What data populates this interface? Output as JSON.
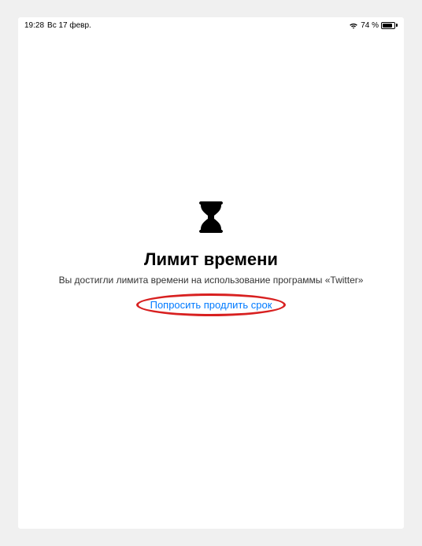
{
  "status_bar": {
    "time": "19:28",
    "date": "Вс 17 февр.",
    "battery_percent": "74 %"
  },
  "screen": {
    "title": "Лимит времени",
    "subtitle": "Вы достигли лимита времени на использование программы «Twitter»",
    "request_button_label": "Попросить продлить срок"
  }
}
